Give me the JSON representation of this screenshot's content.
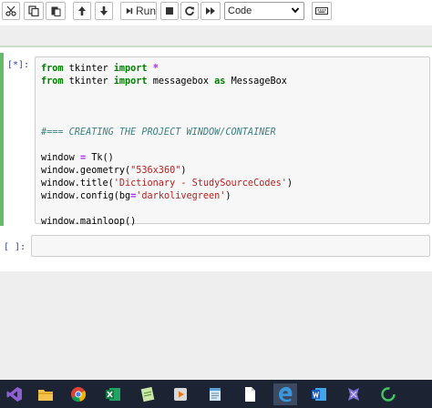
{
  "toolbar": {
    "run_label": "Run",
    "cell_type_selected": "Code"
  },
  "cells": [
    {
      "prompt": "[*]:",
      "lines": [
        "from tkinter import *",
        "from tkinter import messagebox as MessageBox",
        "",
        "",
        "",
        "#=== CREATING THE PROJECT WINDOW/CONTAINER",
        "",
        "window = Tk()",
        "window.geometry(\"536x360\")",
        "window.title('Dictionary - StudySourceCodes')",
        "window.config(bg='darkolivegreen')",
        "",
        "window.mainloop()"
      ]
    },
    {
      "prompt": "[ ]:",
      "lines": []
    }
  ],
  "taskbar": {
    "icons": [
      "visual-studio-icon",
      "file-explorer-icon",
      "chrome-icon",
      "excel-icon",
      "notepad-plus-icon",
      "media-player-icon",
      "notepad-icon",
      "document-icon",
      "edge-icon",
      "word-icon",
      "python-idle-icon",
      "loading-circle-icon"
    ]
  }
}
